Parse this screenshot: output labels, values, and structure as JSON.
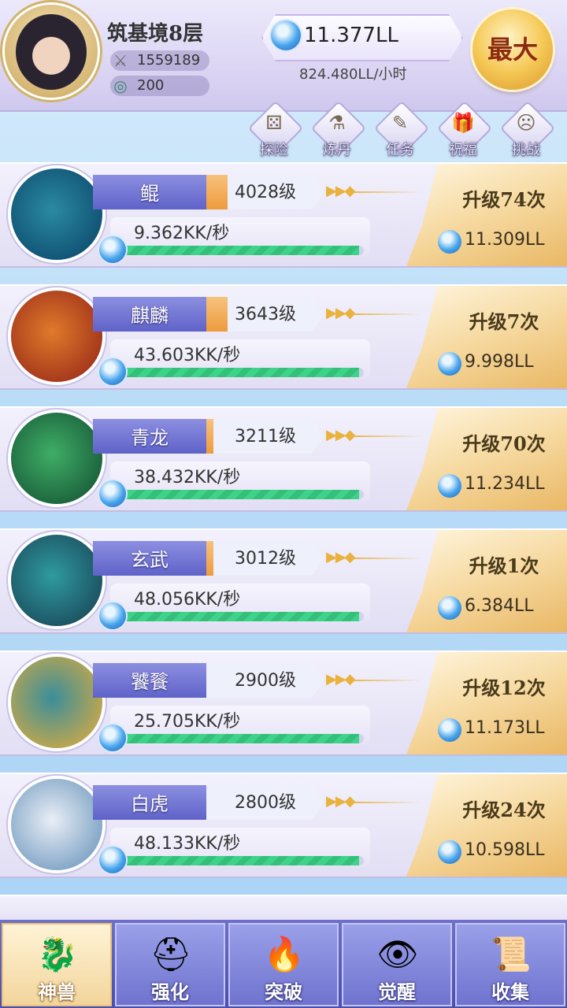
{
  "player": {
    "realm": "筑基境8层",
    "power": "1559189",
    "jade": "200"
  },
  "currency": {
    "amount": "11.377LL",
    "rate": "824.480LL/小时"
  },
  "max_button": "最大",
  "nav": [
    {
      "label": "探险",
      "icon": "dice-icon"
    },
    {
      "label": "炼丹",
      "icon": "alchemy-icon"
    },
    {
      "label": "任务",
      "icon": "scroll-icon"
    },
    {
      "label": "祝福",
      "icon": "gift-icon"
    },
    {
      "label": "挑战",
      "icon": "mask-icon"
    }
  ],
  "beasts": [
    {
      "name": "鲲",
      "level": "4028级",
      "level_fill": 0.18,
      "rate": "9.362KK/秒",
      "progress": 0.98,
      "upgrade": "升级74次",
      "cost": "11.309LL",
      "colors": [
        "#2a8aa0",
        "#0f4f72"
      ]
    },
    {
      "name": "麒麟",
      "level": "3643级",
      "level_fill": 0.18,
      "rate": "43.603KK/秒",
      "progress": 0.98,
      "upgrade": "升级7次",
      "cost": "9.998LL",
      "colors": [
        "#e07a2b",
        "#a0321a"
      ]
    },
    {
      "name": "青龙",
      "level": "3211级",
      "level_fill": 0.06,
      "rate": "38.432KK/秒",
      "progress": 0.98,
      "upgrade": "升级70次",
      "cost": "11.234LL",
      "colors": [
        "#3fae66",
        "#1a5e3a"
      ]
    },
    {
      "name": "玄武",
      "level": "3012级",
      "level_fill": 0.06,
      "rate": "48.056KK/秒",
      "progress": 0.98,
      "upgrade": "升级1次",
      "cost": "6.384LL",
      "colors": [
        "#2f9aa0",
        "#1b4e5e"
      ]
    },
    {
      "name": "饕餮",
      "level": "2900级",
      "level_fill": 0.0,
      "rate": "25.705KK/秒",
      "progress": 0.98,
      "upgrade": "升级12次",
      "cost": "11.173LL",
      "colors": [
        "#3a8e9a",
        "#c8a84a"
      ]
    },
    {
      "name": "白虎",
      "level": "2800级",
      "level_fill": 0.0,
      "rate": "48.133KK/秒",
      "progress": 0.98,
      "upgrade": "升级24次",
      "cost": "10.598LL",
      "colors": [
        "#e9eef5",
        "#7aa0c4"
      ]
    }
  ],
  "tabs": [
    {
      "label": "神兽",
      "icon": "qilin-icon",
      "glyph": "🐉",
      "active": true
    },
    {
      "label": "强化",
      "icon": "helmet-icon",
      "glyph": "⛑",
      "active": false
    },
    {
      "label": "突破",
      "icon": "fire-orb-icon",
      "glyph": "🔥",
      "active": false
    },
    {
      "label": "觉醒",
      "icon": "eye-icon",
      "glyph": "👁",
      "active": false
    },
    {
      "label": "收集",
      "icon": "scroll-book-icon",
      "glyph": "📜",
      "active": false
    }
  ]
}
